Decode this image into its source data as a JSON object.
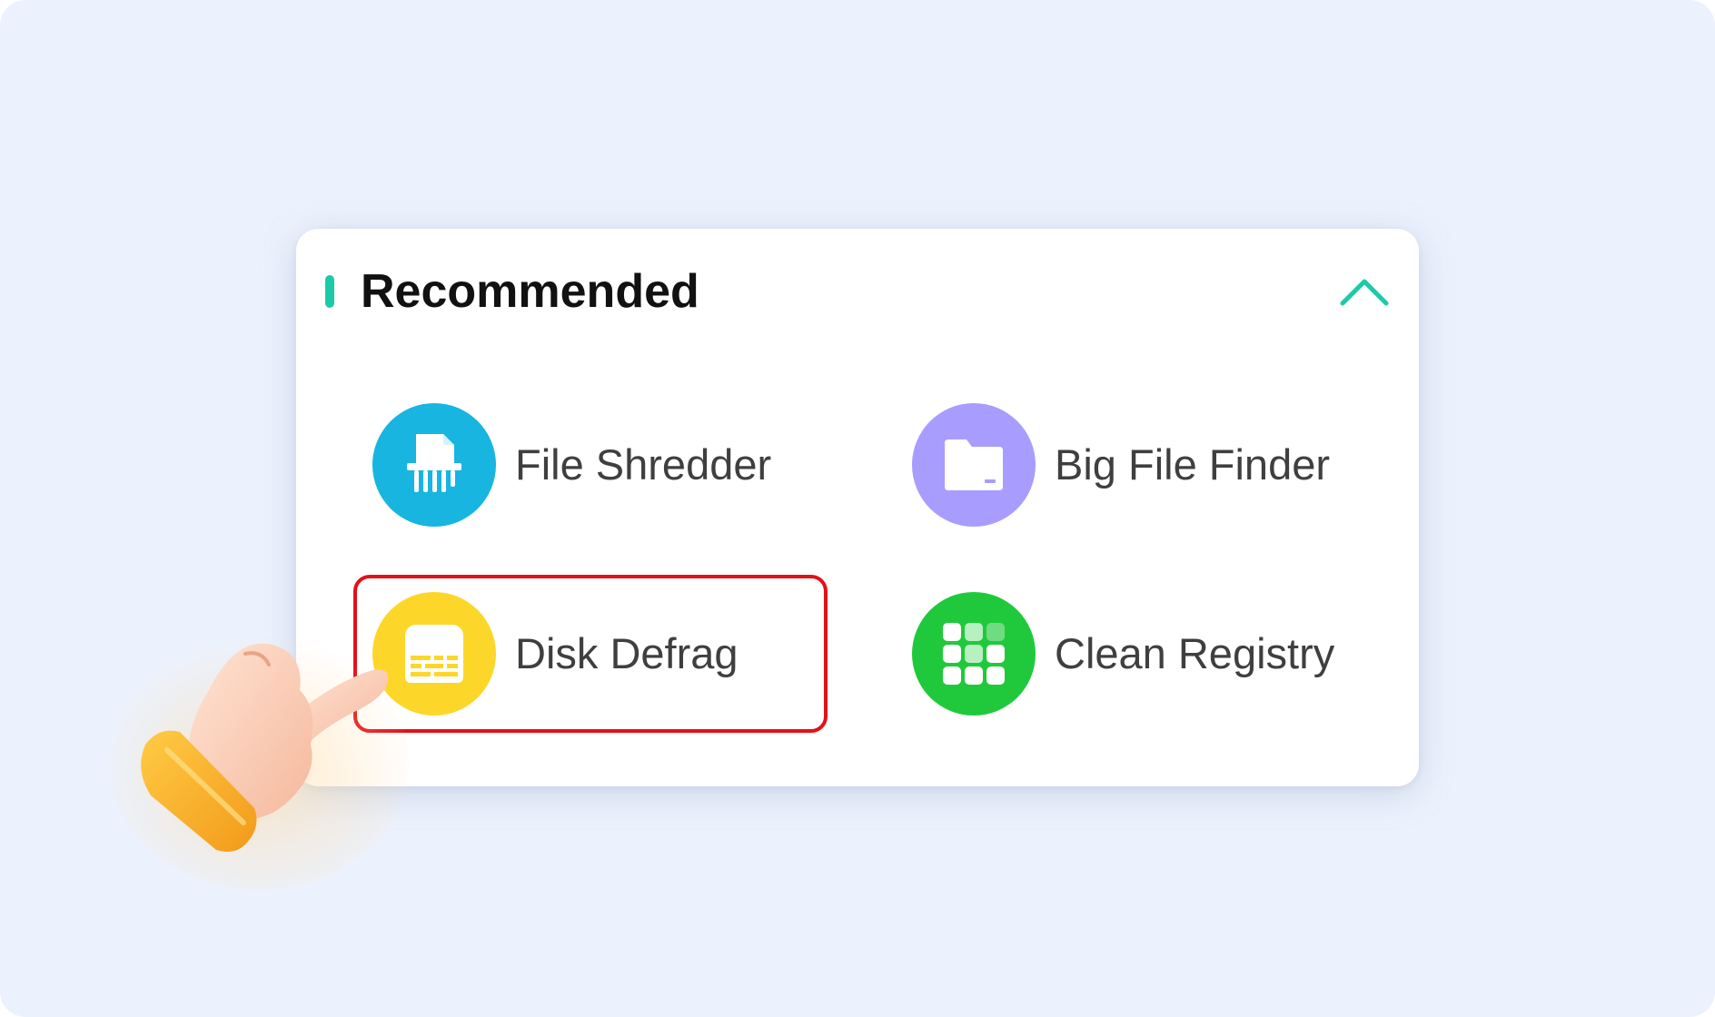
{
  "section": {
    "title": "Recommended",
    "accent_color": "#1ccaa8",
    "collapse_icon": "chevron-up-icon"
  },
  "tools": [
    {
      "label": "File Shredder",
      "icon": "shredder-icon",
      "color": "#17b5e0"
    },
    {
      "label": "Big File Finder",
      "icon": "folder-icon",
      "color": "#a99cff"
    },
    {
      "label": "Disk Defrag",
      "icon": "disk-defrag-icon",
      "color": "#fdd62a",
      "highlighted": true
    },
    {
      "label": "Clean Registry",
      "icon": "registry-grid-icon",
      "color": "#20c93b"
    }
  ],
  "highlight_color": "#e41018",
  "pointer_icon": "pointing-hand-icon"
}
